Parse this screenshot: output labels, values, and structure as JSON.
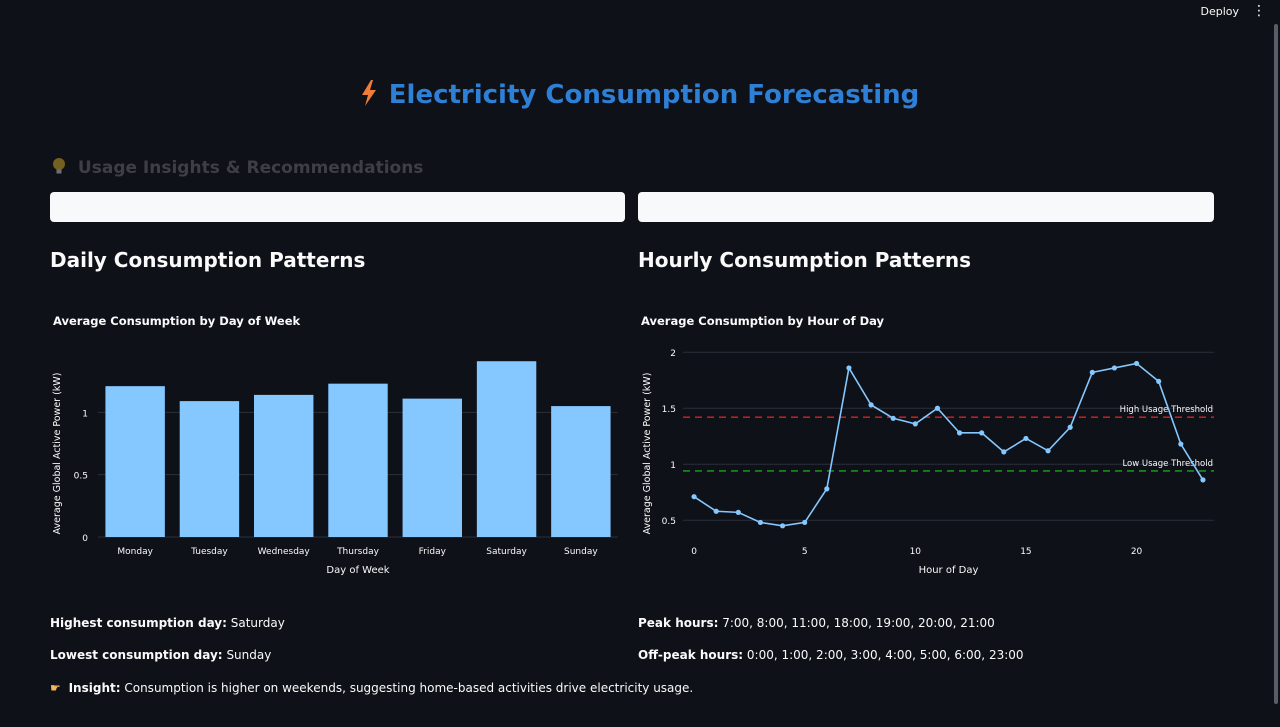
{
  "header": {
    "deploy_label": "Deploy",
    "menu_icon": "more-vertical-icon"
  },
  "page": {
    "title": "Electricity Consumption Forecasting",
    "title_icon": "lightning-icon",
    "section_title": "Usage Insights & Recommendations",
    "section_icon": "light-bulb-icon"
  },
  "colors": {
    "accent": "#2e7fd6",
    "bar": "#85c7ff",
    "line": "#85c7ff",
    "high": "#e02020",
    "low": "#1ca51c",
    "bg": "#0e1117"
  },
  "daily": {
    "heading": "Daily Consumption Patterns",
    "chart_title": "Average Consumption by Day of Week",
    "highest_label": "Highest consumption day:",
    "highest_value": "Saturday",
    "lowest_label": "Lowest consumption day:",
    "lowest_value": "Sunday",
    "insight_label": "Insight:",
    "insight_text": "Consumption is higher on weekends, suggesting home-based activities drive electricity usage.",
    "insight_icon": "pointing-hand-icon"
  },
  "hourly": {
    "heading": "Hourly Consumption Patterns",
    "chart_title": "Average Consumption by Hour of Day",
    "peak_label": "Peak hours:",
    "peak_value": "7:00, 8:00, 11:00, 18:00, 19:00, 20:00, 21:00",
    "offpeak_label": "Off-peak hours:",
    "offpeak_value": "0:00, 1:00, 2:00, 3:00, 4:00, 5:00, 6:00, 23:00"
  },
  "chart_data": [
    {
      "type": "bar",
      "title": "Average Consumption by Day of Week",
      "xlabel": "Day of Week",
      "ylabel": "Average Global Active Power (kW)",
      "categories": [
        "Monday",
        "Tuesday",
        "Wednesday",
        "Thursday",
        "Friday",
        "Saturday",
        "Sunday"
      ],
      "values": [
        1.21,
        1.09,
        1.14,
        1.23,
        1.11,
        1.41,
        1.05
      ],
      "ylim": [
        0,
        1.5
      ],
      "yticks": [
        0,
        0.5,
        1
      ],
      "ytick_labels": [
        "0",
        "0.5",
        "1"
      ],
      "grid": true
    },
    {
      "type": "line",
      "title": "Average Consumption by Hour of Day",
      "xlabel": "Hour of Day",
      "ylabel": "Average Global Active Power (kW)",
      "x": [
        0,
        1,
        2,
        3,
        4,
        5,
        6,
        7,
        8,
        9,
        10,
        11,
        12,
        13,
        14,
        15,
        16,
        17,
        18,
        19,
        20,
        21,
        22,
        23
      ],
      "y": [
        0.71,
        0.58,
        0.57,
        0.48,
        0.45,
        0.48,
        0.78,
        1.86,
        1.53,
        1.41,
        1.36,
        1.5,
        1.28,
        1.28,
        1.11,
        1.23,
        1.12,
        1.33,
        1.82,
        1.86,
        1.9,
        1.74,
        1.18,
        0.86
      ],
      "xlim": [
        -0.5,
        23.5
      ],
      "ylim": [
        0.35,
        2.02
      ],
      "xticks": [
        0,
        5,
        10,
        15,
        20
      ],
      "yticks": [
        0.5,
        1,
        1.5,
        2
      ],
      "ytick_labels": [
        "0.5",
        "1",
        "1.5",
        "2"
      ],
      "thresholds": [
        {
          "name": "High Usage Threshold",
          "value": 1.42
        },
        {
          "name": "Low Usage Threshold",
          "value": 0.94
        }
      ],
      "grid": true
    }
  ]
}
